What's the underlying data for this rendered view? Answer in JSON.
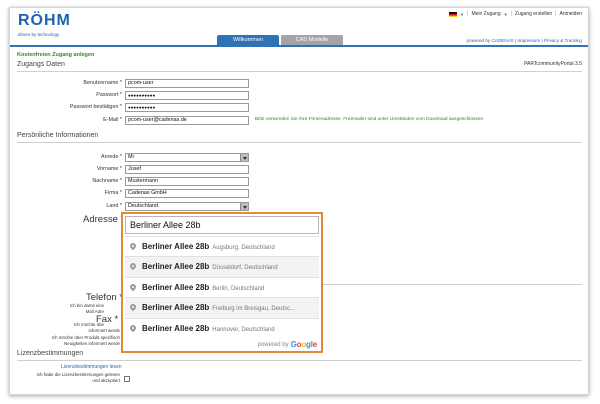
{
  "brand": {
    "name": "RÖHM",
    "tagline": "driven by technology"
  },
  "topnav": {
    "my_access": "Mein Zugang",
    "create_access": "Zugang erstellen",
    "login": "Anmelden"
  },
  "tabs": [
    {
      "label": "Willkommen",
      "active": true
    },
    {
      "label": "CAD Modelle",
      "active": false
    }
  ],
  "footer_links": {
    "powered": "powered by CADENAS",
    "impressum": "Impressum",
    "privacy": "Privacy & Tracking"
  },
  "page": {
    "title": "Kostenfreien Zugang anlegen",
    "portal_version": "PARTcommunityPortal 3.5"
  },
  "sections": {
    "access": "Zugangs Daten",
    "personal": "Persönliche Informationen",
    "license": "Lizenzbestimmungen"
  },
  "access_fields": [
    {
      "label": "Benutzername *",
      "value": "pcom-user"
    },
    {
      "label": "Passwort *",
      "value": "●●●●●●●●●●"
    },
    {
      "label": "Passwort bestätigen *",
      "value": "●●●●●●●●●●"
    },
    {
      "label": "E-Mail *",
      "value": "pcom-user@cadenas.de"
    }
  ],
  "email_hint": "Bitte verwenden Sie Ihre Firmenadresse, Freemailer sind unter Umständen vom Download ausgeschlossen",
  "personal_fields": {
    "anrede": {
      "label": "Anrede *",
      "value": "Mr"
    },
    "vorname": {
      "label": "Vorname *",
      "value": "Josef"
    },
    "nachname": {
      "label": "Nachname *",
      "value": "Mustermann"
    },
    "firma": {
      "label": "Firma *",
      "value": "Cadenas GmbH"
    },
    "land": {
      "label": "Land *",
      "value": "Deutschland"
    }
  },
  "adresse": {
    "label": "Adresse *",
    "value": "Berliner Allee 28b"
  },
  "autocomplete": [
    {
      "main": "Berliner Allee 28b",
      "secondary": "Augsburg, Deutschland"
    },
    {
      "main": "Berliner Allee 28b",
      "secondary": "Düsseldorf, Deutschland"
    },
    {
      "main": "Berliner Allee 28b",
      "secondary": "Berlin, Deutschland"
    },
    {
      "main": "Berliner Allee 28b",
      "secondary": "Freiburg im Breisgau, Deutsc..."
    },
    {
      "main": "Berliner Allee 28b",
      "secondary": "Hannover, Deutschland"
    }
  ],
  "autocomplete_footer": {
    "powered": "powered by",
    "google": "Google"
  },
  "telefon_label": "Telefon *",
  "fax_label": "Fax *",
  "partial_texts": {
    "line1a": "Ich bin damit einv",
    "line1b": "Mail Adre",
    "line2": "Ich möchte übe",
    "line3": "informiert werde",
    "line4": "Ich möchte über Produkt spezifisch",
    "line5": "Neuigkeiten informiert werde"
  },
  "license": {
    "link": "Lizenzbestimmungen lesen",
    "accept_line1": "Ich habe die Lizenzbestimmungen gelesen",
    "accept_line2": "und akzeptiert"
  },
  "colors": {
    "accent": "#2f73b7",
    "highlight": "#e38a3a",
    "green": "#2d8a2d"
  }
}
